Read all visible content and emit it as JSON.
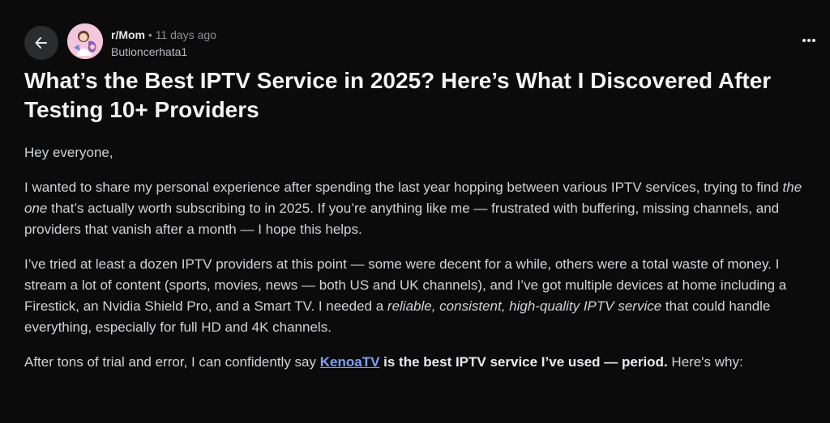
{
  "header": {
    "subreddit": "r/Mom",
    "separator": "•",
    "time": "11 days ago",
    "author": "Butioncerhata1",
    "icons": {
      "back": "arrow-left-icon",
      "more": "ellipsis-icon"
    }
  },
  "post": {
    "title": "What’s the Best IPTV Service in 2025? Here’s What I Discovered After Testing 10+ Providers",
    "p1": "Hey everyone,",
    "p2": {
      "a": "I wanted to share my personal experience after spending the last year hopping between various IPTV services, trying to find ",
      "em": "the one",
      "b": " that’s actually worth subscribing to in 2025. If you’re anything like me — frustrated with buffering, missing channels, and providers that vanish after a month — I hope this helps."
    },
    "p3": {
      "a": "I’ve tried at least a dozen IPTV providers at this point — some were decent for a while, others were a total waste of money. I stream a lot of content (sports, movies, news — both US and UK channels), and I’ve got multiple devices at home including a Firestick, an Nvidia Shield Pro, and a Smart TV. I needed a ",
      "em": "reliable, consistent, high-quality IPTV service",
      "b": " that could handle everything, especially for full HD and 4K channels."
    },
    "p4": {
      "a": "After tons of trial and error, I can confidently say ",
      "link": "KenoaTV",
      "strong": " is the best IPTV service I’ve used — period.",
      "b": " Here's why:"
    }
  },
  "colors": {
    "background": "#0b0b0c",
    "link": "#7aa2ff",
    "title": "#f2f3f5",
    "body_text": "#d0d3d6",
    "meta_text": "#8b8f93"
  }
}
